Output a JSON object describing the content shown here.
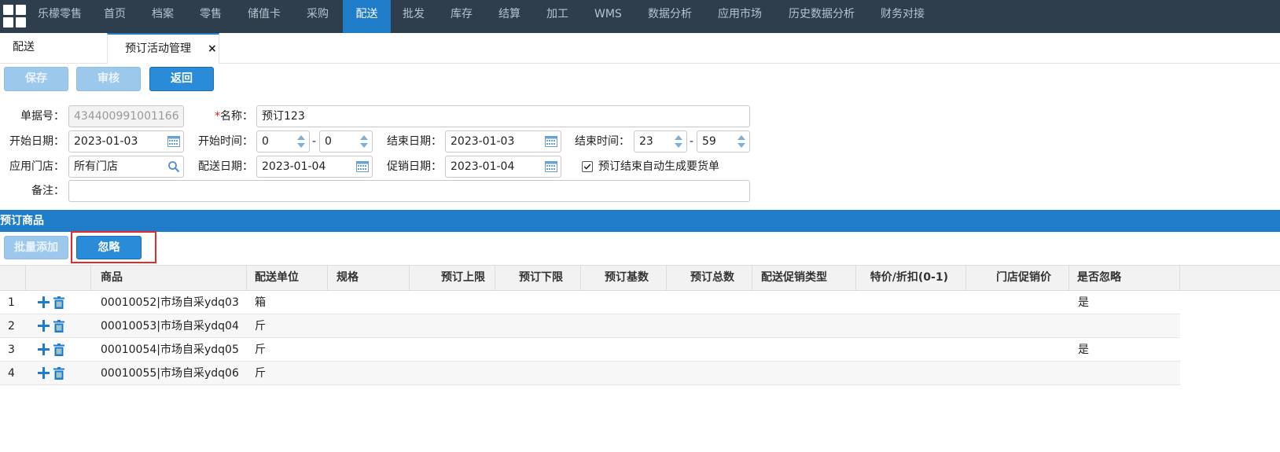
{
  "nav": {
    "items": [
      "乐檬零售",
      "首页",
      "档案",
      "零售",
      "储值卡",
      "采购",
      "配送",
      "批发",
      "库存",
      "结算",
      "加工",
      "WMS",
      "数据分析",
      "应用市场",
      "历史数据分析",
      "财务对接"
    ],
    "active": "配送"
  },
  "tabs": {
    "first": "配送",
    "active": "预订活动管理",
    "close": "×"
  },
  "toolbar": {
    "save": "保存",
    "audit": "审核",
    "back": "返回"
  },
  "form": {
    "doc_no_label": "单据号：",
    "doc_no": "434400991001166",
    "name_req": "*",
    "name_label": "名称：",
    "name": "预订123",
    "start_date_label": "开始日期：",
    "start_date": "2023-01-03",
    "start_time_label": "开始时间：",
    "start_hour": "0",
    "start_min": "0",
    "end_date_label": "结束日期：",
    "end_date": "2023-01-03",
    "end_time_label": "结束时间：",
    "end_hour": "23",
    "end_min": "59",
    "store_label": "应用门店：",
    "store": "所有门店",
    "delivery_date_label": "配送日期：",
    "delivery_date": "2023-01-04",
    "promo_date_label": "促销日期：",
    "promo_date": "2023-01-04",
    "auto_order_label": "预订结束自动生成要货单",
    "auto_order_checked": true,
    "remark_label": "备注：",
    "remark": "",
    "dash": "-"
  },
  "section": {
    "title": "预订商品",
    "batch_add": "批量添加",
    "ignore": "忽略"
  },
  "table": {
    "headers": [
      "商品",
      "配送单位",
      "规格",
      "预订上限",
      "预订下限",
      "预订基数",
      "预订总数",
      "配送促销类型",
      "特价/折扣(0-1)",
      "门店促销价",
      "是否忽略"
    ],
    "rows": [
      {
        "no": "1",
        "product": "00010052|市场自采ydq03",
        "unit": "箱",
        "ignore": "是"
      },
      {
        "no": "2",
        "product": "00010053|市场自采ydq04",
        "unit": "斤",
        "ignore": ""
      },
      {
        "no": "3",
        "product": "00010054|市场自采ydq05",
        "unit": "斤",
        "ignore": "是"
      },
      {
        "no": "4",
        "product": "00010055|市场自采ydq06",
        "unit": "斤",
        "ignore": ""
      }
    ]
  },
  "colors": {
    "nav_bg": "#2f3e4d",
    "accent": "#1e7cc8",
    "highlight": "#e52a2a"
  },
  "icons": [
    "grid-logo-icon",
    "calendar-icon",
    "spinner-icon",
    "search-icon",
    "checkbox-icon",
    "plus-icon",
    "trash-icon"
  ]
}
